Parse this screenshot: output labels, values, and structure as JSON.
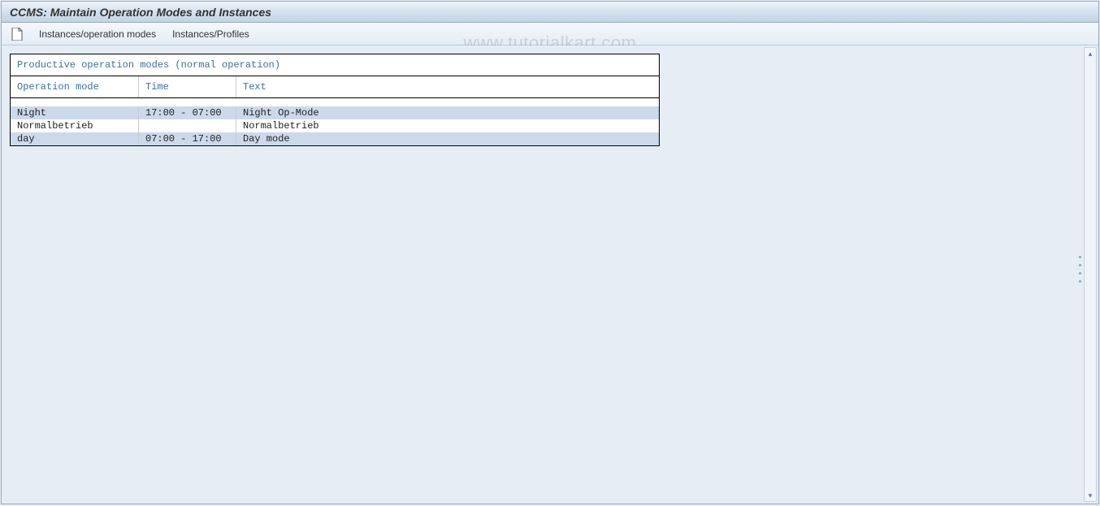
{
  "header": {
    "title": "CCMS: Maintain Operation Modes and Instances"
  },
  "toolbar": {
    "new_icon": "new-document-icon",
    "link1": "Instances/operation modes",
    "link2": "Instances/Profiles"
  },
  "table": {
    "title": "Productive operation modes (normal operation)",
    "columns": {
      "mode": "Operation mode",
      "time": "Time",
      "text": "Text"
    },
    "rows": [
      {
        "mode": "Night",
        "time": "17:00 - 07:00",
        "text": "Night Op-Mode"
      },
      {
        "mode": "Normalbetrieb",
        "time": "",
        "text": "Normalbetrieb"
      },
      {
        "mode": "day",
        "time": "07:00 - 17:00",
        "text": "Day mode"
      }
    ]
  },
  "watermark": "www.tutorialkart.com"
}
